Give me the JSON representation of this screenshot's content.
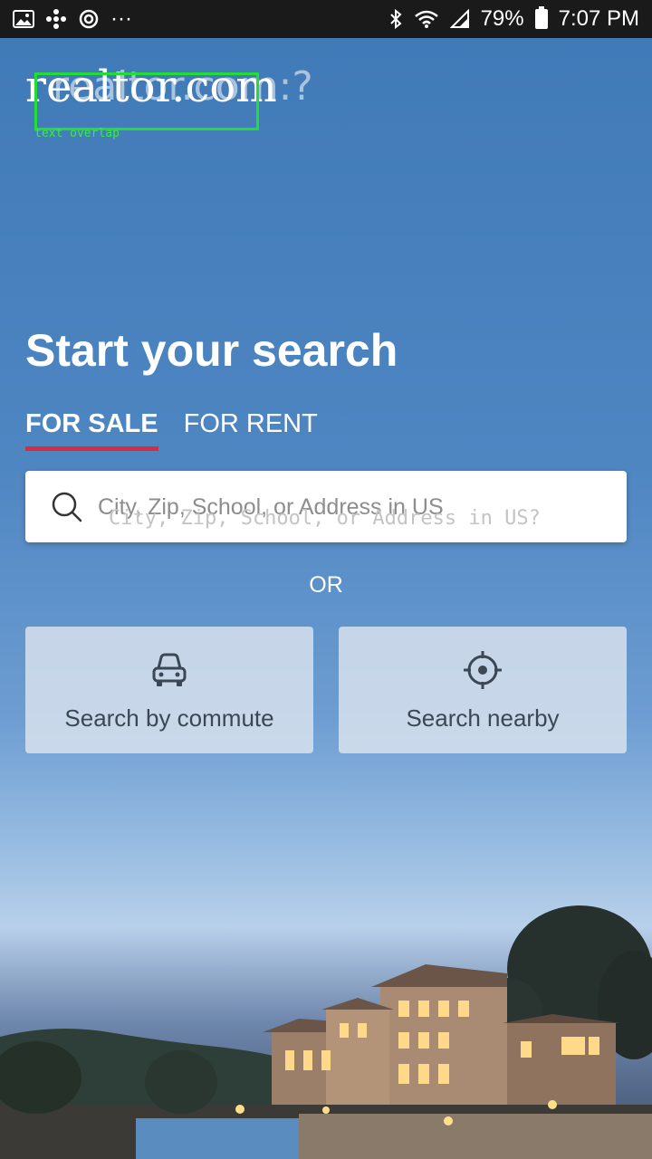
{
  "status_bar": {
    "battery": "79%",
    "time": "7:07 PM",
    "more": "···"
  },
  "logo": {
    "text": "realtor.com",
    "ghost_text": "realtor.com:?",
    "overlay_label": "text overlap"
  },
  "headline": "Start your search",
  "tabs": [
    {
      "label": "FOR SALE",
      "active": true
    },
    {
      "label": "FOR RENT",
      "active": false
    }
  ],
  "search": {
    "placeholder": "City, Zip, School, or Address in US",
    "ghost_text": "City, Zip, School, or Address in US?"
  },
  "or_text": "OR",
  "options": {
    "commute": {
      "label": "Search by commute",
      "icon": "car-icon"
    },
    "nearby": {
      "label": "Search nearby",
      "icon": "crosshair-icon"
    }
  },
  "colors": {
    "accent": "#d92b3a",
    "card_text": "#3b4754"
  }
}
